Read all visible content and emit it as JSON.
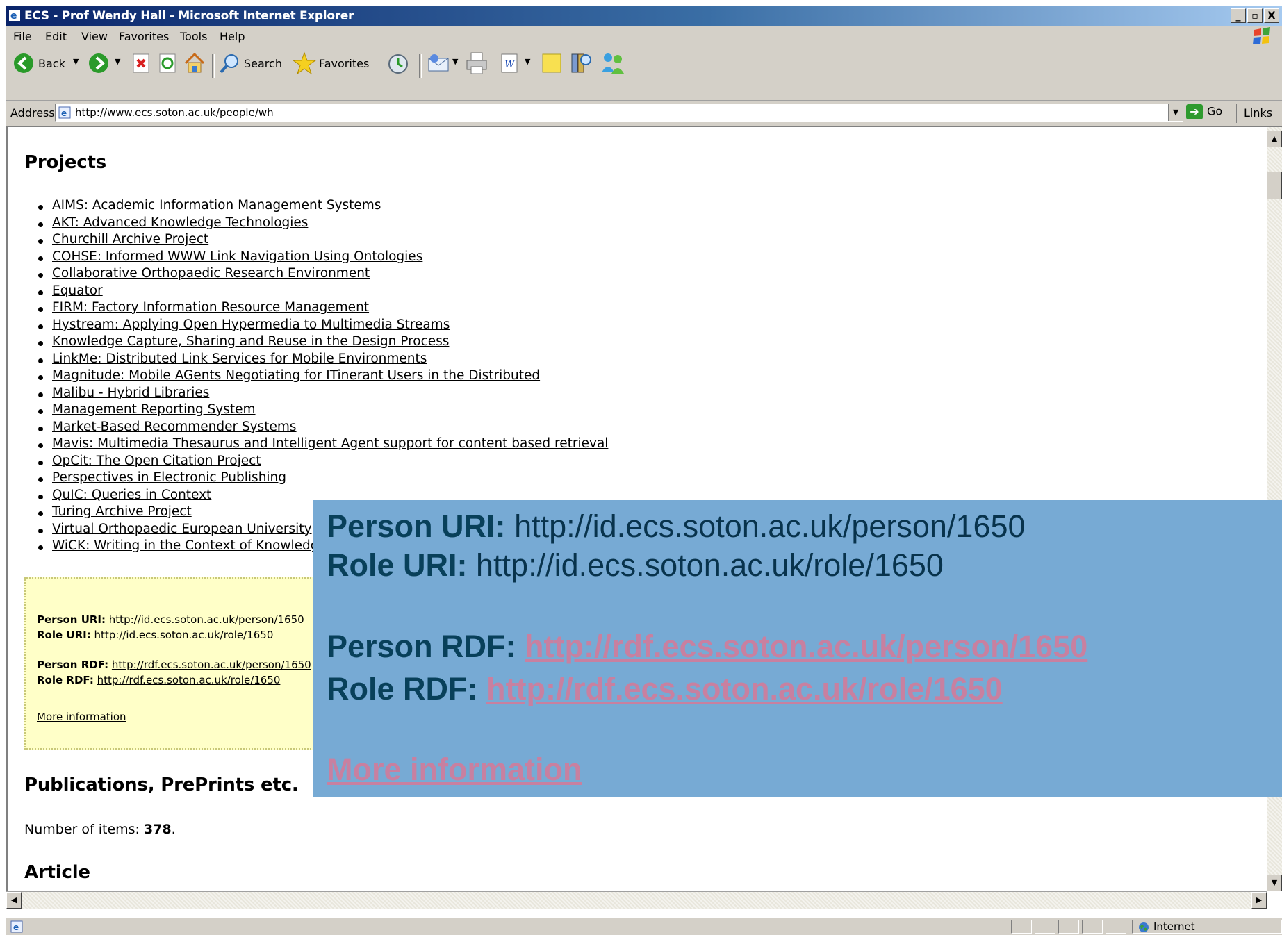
{
  "window": {
    "title": "ECS - Prof Wendy Hall - Microsoft Internet Explorer",
    "minimize": "_",
    "maximize": "▫",
    "close": "X"
  },
  "menu": {
    "file": "File",
    "edit": "Edit",
    "view": "View",
    "favorites": "Favorites",
    "tools": "Tools",
    "help": "Help"
  },
  "toolbar": {
    "back": "Back",
    "search": "Search",
    "favorites": "Favorites"
  },
  "address": {
    "label": "Address",
    "url": "http://www.ecs.soton.ac.uk/people/wh",
    "go": "Go",
    "links": "Links »"
  },
  "page": {
    "projects_heading": "Projects",
    "projects": [
      "AIMS: Academic Information Management Systems",
      "AKT: Advanced Knowledge Technologies",
      "Churchill Archive Project",
      "COHSE: Informed WWW Link Navigation Using Ontologies",
      "Collaborative Orthopaedic Research Environment",
      "Equator",
      "FIRM: Factory Information Resource Management",
      "Hystream: Applying Open Hypermedia to Multimedia Streams",
      "Knowledge Capture, Sharing and Reuse in the Design Process",
      "LinkMe: Distributed Link Services for Mobile Environments",
      "Magnitude: Mobile AGents Negotiating for ITinerant Users in the Distributed",
      "Malibu - Hybrid Libraries",
      "Management Reporting System",
      "Market-Based Recommender Systems",
      "Mavis: Multimedia Thesaurus and Intelligent Agent support for content based retrieval",
      "OpCit: The Open Citation Project",
      "Perspectives in Electronic Publishing",
      "QuIC: Queries in Context",
      "Turing Archive Project",
      "Virtual Orthopaedic European University",
      "WiCK: Writing in the Context of Knowledge"
    ],
    "info_box": {
      "person_uri_label": "Person URI:",
      "person_uri": "http://id.ecs.soton.ac.uk/person/1650",
      "role_uri_label": "Role URI:",
      "role_uri": "http://id.ecs.soton.ac.uk/role/1650",
      "person_rdf_label": "Person RDF:",
      "person_rdf": "http://rdf.ecs.soton.ac.uk/person/1650",
      "role_rdf_label": "Role RDF:",
      "role_rdf": "http://rdf.ecs.soton.ac.uk/role/1650",
      "more_info": "More information"
    },
    "publications_heading": "Publications, PrePrints etc.",
    "items_label": "Number of items:",
    "items_count": "378",
    "items_suffix": ".",
    "article_heading": "Article"
  },
  "overlay": {
    "person_uri_label": "Person URI:",
    "person_uri": "http://id.ecs.soton.ac.uk/person/1650",
    "role_uri_label": "Role URI:",
    "role_uri": "http://id.ecs.soton.ac.uk/role/1650",
    "person_rdf_label": "Person RDF:",
    "person_rdf": "http://rdf.ecs.soton.ac.uk/person/1650",
    "role_rdf_label": "Role RDF:",
    "role_rdf": "http://rdf.ecs.soton.ac.uk/role/1650",
    "more_info": "More information"
  },
  "status": {
    "zone": "Internet"
  },
  "colors": {
    "overlay_bg": "#77aad4",
    "overlay_text": "#08334c",
    "overlay_link": "#c880a0",
    "info_box_bg": "#ffffc8"
  }
}
